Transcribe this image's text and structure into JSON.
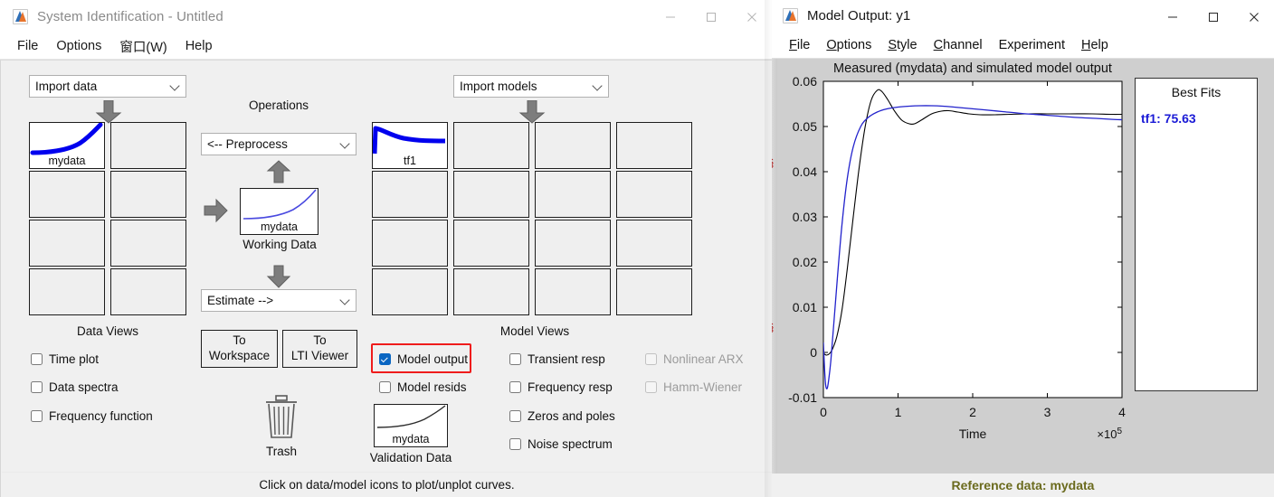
{
  "sysid": {
    "title": "System Identification - Untitled",
    "app_icon": "matlab-icon",
    "menu": [
      "File",
      "Options",
      "窗口(W)",
      "Help"
    ],
    "window_controls": {
      "minimize": "–",
      "maximize": "□",
      "close": "✕"
    },
    "import_data_label": "Import data",
    "import_models_label": "Import models",
    "operations_label": "Operations",
    "preprocess_label": "<-- Preprocess",
    "estimate_label": "Estimate -->",
    "working_data_label": "Working Data",
    "working_data_name": "mydata",
    "data_views_label": "Data Views",
    "model_views_label": "Model Views",
    "data_icons": [
      {
        "name": "mydata",
        "filled": true
      },
      {
        "name": "",
        "filled": false
      },
      {
        "name": "",
        "filled": false
      },
      {
        "name": "",
        "filled": false
      },
      {
        "name": "",
        "filled": false
      },
      {
        "name": "",
        "filled": false
      },
      {
        "name": "",
        "filled": false
      },
      {
        "name": "",
        "filled": false
      }
    ],
    "model_icons": [
      {
        "name": "tf1",
        "filled": true
      },
      {
        "name": "",
        "filled": false
      },
      {
        "name": "",
        "filled": false
      },
      {
        "name": "",
        "filled": false
      },
      {
        "name": "",
        "filled": false
      },
      {
        "name": "",
        "filled": false
      },
      {
        "name": "",
        "filled": false
      },
      {
        "name": "",
        "filled": false
      },
      {
        "name": "",
        "filled": false
      },
      {
        "name": "",
        "filled": false
      },
      {
        "name": "",
        "filled": false
      },
      {
        "name": "",
        "filled": false
      },
      {
        "name": "",
        "filled": false
      },
      {
        "name": "",
        "filled": false
      },
      {
        "name": "",
        "filled": false
      },
      {
        "name": "",
        "filled": false
      }
    ],
    "data_view_checks": [
      {
        "label": "Time plot",
        "checked": false,
        "disabled": false
      },
      {
        "label": "Data spectra",
        "checked": false,
        "disabled": false
      },
      {
        "label": "Frequency function",
        "checked": false,
        "disabled": false
      }
    ],
    "model_view_checks_col1": [
      {
        "label": "Model output",
        "checked": true,
        "disabled": false,
        "highlighted": true
      },
      {
        "label": "Model resids",
        "checked": false,
        "disabled": false,
        "highlighted": false
      }
    ],
    "model_view_checks_col2": [
      {
        "label": "Transient resp",
        "checked": false,
        "disabled": false
      },
      {
        "label": "Frequency resp",
        "checked": false,
        "disabled": false
      },
      {
        "label": "Zeros and poles",
        "checked": false,
        "disabled": false
      },
      {
        "label": "Noise spectrum",
        "checked": false,
        "disabled": false
      }
    ],
    "model_view_checks_col3": [
      {
        "label": "Nonlinear ARX",
        "checked": false,
        "disabled": true
      },
      {
        "label": "Hamm-Wiener",
        "checked": false,
        "disabled": true
      }
    ],
    "to_workspace_line1": "To",
    "to_workspace_line2": "Workspace",
    "to_lti_line1": "To",
    "to_lti_line2": "LTI Viewer",
    "trash_label": "Trash",
    "trash_icon": "trash-icon",
    "validation_data_label": "Validation Data",
    "validation_data_name": "mydata",
    "status_text": "Click on data/model icons to plot/unplot curves.",
    "highlight_color": "#ef1c1c"
  },
  "modeloutput": {
    "title": "Model Output: y1",
    "app_icon": "matlab-icon",
    "menu": [
      {
        "mn": "F",
        "rest": "ile"
      },
      {
        "mn": "O",
        "rest": "ptions"
      },
      {
        "mn": "S",
        "rest": "tyle"
      },
      {
        "mn": "C",
        "rest": "hannel"
      },
      {
        "mn": "",
        "rest": "Experiment"
      },
      {
        "mn": "H",
        "rest": "elp"
      }
    ],
    "window_controls": {
      "minimize": "–",
      "maximize": "□",
      "close": "✕"
    },
    "best_fits_title": "Best Fits",
    "best_fits_entries": [
      {
        "label": "tf1: 75.63",
        "color": "#1a1ad6"
      }
    ],
    "status_text": "Reference data:  mydata",
    "status_color": "#6b6b1e",
    "edge_fragments": [
      "§",
      "[",
      "§",
      "["
    ]
  },
  "chart_data": {
    "type": "line",
    "title": "Measured (mydata) and simulated model output",
    "xlabel": "Time",
    "ylabel": "",
    "x_multiplier": "×10⁵",
    "xlim": [
      0,
      4
    ],
    "ylim": [
      -0.01,
      0.06
    ],
    "xticks": [
      0,
      1,
      2,
      3,
      4
    ],
    "xticklabels": [
      "0",
      "1",
      "2",
      "3",
      "4"
    ],
    "yticks": [
      -0.01,
      0,
      0.01,
      0.02,
      0.03,
      0.04,
      0.05,
      0.06
    ],
    "yticklabels": [
      "-0.01",
      "0",
      "0.01",
      "0.02",
      "0.03",
      "0.04",
      "0.05",
      "0.06"
    ],
    "grid": false,
    "legend": "none",
    "series": [
      {
        "name": "Measured (mydata)",
        "color": "#000000",
        "x": [
          0,
          0.04,
          0.08,
          0.12,
          0.18,
          0.25,
          0.32,
          0.4,
          0.48,
          0.56,
          0.64,
          0.72,
          0.78,
          0.86,
          0.95,
          1.05,
          1.15,
          1.22,
          1.32,
          1.45,
          1.58,
          1.68,
          1.8,
          1.95,
          2.1,
          2.3,
          2.5,
          2.75,
          3.0,
          3.3,
          3.6,
          3.85,
          4.0
        ],
        "y": [
          -0.0002,
          -0.0006,
          -0.0003,
          0.0007,
          0.0035,
          0.0095,
          0.0185,
          0.03,
          0.041,
          0.05,
          0.0558,
          0.058,
          0.0578,
          0.056,
          0.0535,
          0.0514,
          0.0506,
          0.0506,
          0.0515,
          0.0528,
          0.0534,
          0.0535,
          0.0532,
          0.0528,
          0.0526,
          0.0526,
          0.0527,
          0.0528,
          0.0528,
          0.0528,
          0.0528,
          0.0527,
          0.0527
        ]
      },
      {
        "name": "Simulated model output (tf1)",
        "color": "#2222cc",
        "x": [
          0,
          0.015,
          0.03,
          0.05,
          0.07,
          0.1,
          0.14,
          0.19,
          0.25,
          0.32,
          0.4,
          0.5,
          0.6,
          0.72,
          0.85,
          1.0,
          1.15,
          1.3,
          1.45,
          1.6,
          1.75,
          1.95,
          2.15,
          2.4,
          2.65,
          2.9,
          3.15,
          3.4,
          3.65,
          3.85,
          4.0
        ],
        "y": [
          0.0022,
          -0.0035,
          -0.0072,
          -0.008,
          -0.0062,
          -0.0018,
          0.0065,
          0.017,
          0.0285,
          0.0385,
          0.0455,
          0.05,
          0.052,
          0.0532,
          0.0539,
          0.0543,
          0.0545,
          0.0546,
          0.0546,
          0.0545,
          0.0543,
          0.054,
          0.0537,
          0.0533,
          0.0529,
          0.0526,
          0.0523,
          0.052,
          0.0518,
          0.0516,
          0.0515
        ]
      }
    ]
  }
}
